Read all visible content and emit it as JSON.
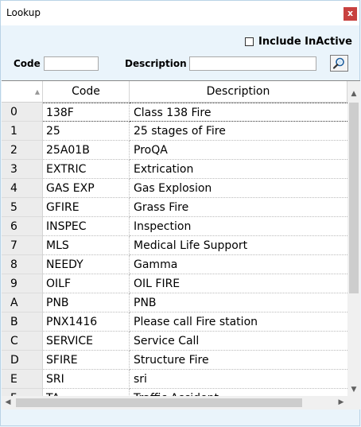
{
  "window": {
    "title": "Lookup",
    "close_label": "x"
  },
  "filters": {
    "include_inactive_label": "Include InActive",
    "code_label": "Code",
    "code_value": "",
    "description_label": "Description",
    "description_value": ""
  },
  "grid": {
    "columns": [
      "",
      "Code",
      "Description"
    ],
    "rows": [
      {
        "idx": "0",
        "code": "138F",
        "desc": "Class 138 Fire"
      },
      {
        "idx": "1",
        "code": "25",
        "desc": "25 stages of Fire"
      },
      {
        "idx": "2",
        "code": "25A01B",
        "desc": "ProQA"
      },
      {
        "idx": "3",
        "code": "EXTRIC",
        "desc": "Extrication"
      },
      {
        "idx": "4",
        "code": "GAS EXP",
        "desc": "Gas Explosion"
      },
      {
        "idx": "5",
        "code": "GFIRE",
        "desc": "Grass Fire"
      },
      {
        "idx": "6",
        "code": "INSPEC",
        "desc": "Inspection"
      },
      {
        "idx": "7",
        "code": "MLS",
        "desc": "Medical Life Support"
      },
      {
        "idx": "8",
        "code": "NEEDY",
        "desc": "Gamma"
      },
      {
        "idx": "9",
        "code": "OILF",
        "desc": "OIL FIRE"
      },
      {
        "idx": "A",
        "code": "PNB",
        "desc": "PNB"
      },
      {
        "idx": "B",
        "code": "PNX1416",
        "desc": "Please call Fire station"
      },
      {
        "idx": "C",
        "code": "SERVICE",
        "desc": "Service Call"
      },
      {
        "idx": "D",
        "code": "SFIRE",
        "desc": "Structure Fire"
      },
      {
        "idx": "E",
        "code": "SRI",
        "desc": "sri"
      },
      {
        "idx": "F",
        "code": "TA",
        "desc": "Traffic Accident"
      }
    ],
    "selected_row": 0
  },
  "icons": {
    "search": "search-icon",
    "sort": "sort-indicator-icon",
    "checkbox": "checkbox-icon"
  },
  "colors": {
    "background": "#eaf4fb",
    "close_button": "#c8413f",
    "row_header": "#ececec"
  }
}
